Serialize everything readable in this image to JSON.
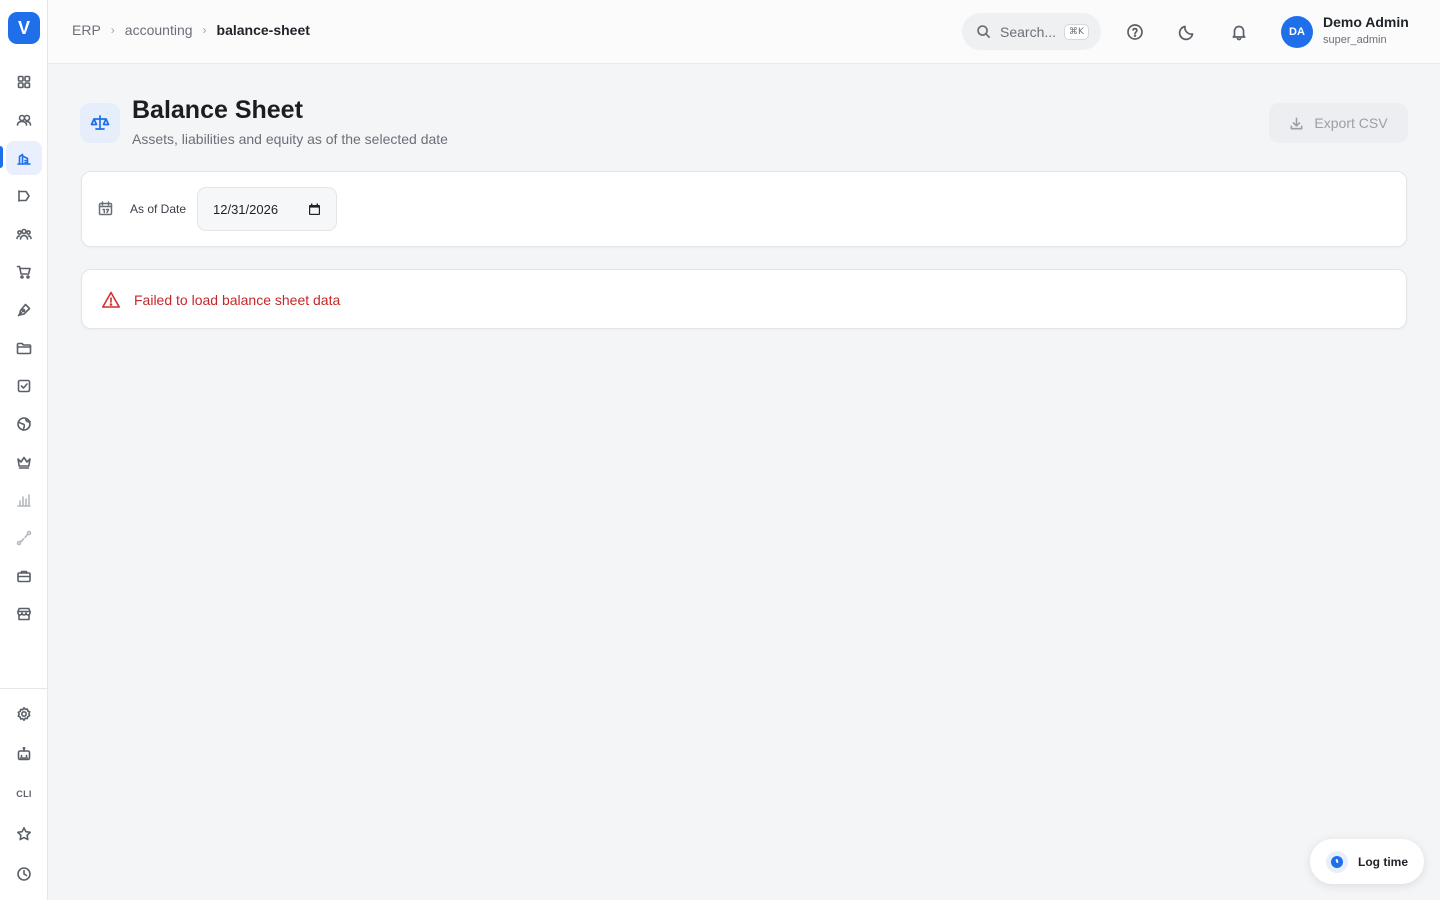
{
  "sidebar": {
    "logo": "V",
    "items": [
      {
        "icon": "dashboard-icon"
      },
      {
        "icon": "users-icon"
      },
      {
        "icon": "accounting-icon",
        "active": true
      },
      {
        "icon": "campaign-icon"
      },
      {
        "icon": "team-icon"
      },
      {
        "icon": "cart-icon"
      },
      {
        "icon": "pen-tool-icon"
      },
      {
        "icon": "folder-icon"
      },
      {
        "icon": "checkbox-icon"
      },
      {
        "icon": "globe-icon"
      },
      {
        "icon": "crown-icon"
      },
      {
        "icon": "bar-chart-icon",
        "disabled": true
      },
      {
        "icon": "route-icon",
        "disabled": true
      },
      {
        "icon": "briefcase-icon"
      },
      {
        "icon": "store-icon"
      }
    ],
    "bottom_items": [
      {
        "icon": "settings-icon"
      },
      {
        "icon": "robot-icon"
      },
      {
        "icon": "cli-icon",
        "label": "CLI"
      },
      {
        "icon": "star-icon"
      },
      {
        "icon": "clock-icon"
      }
    ]
  },
  "topbar": {
    "breadcrumb": [
      "ERP",
      "accounting",
      "balance-sheet"
    ],
    "search_placeholder": "Search...",
    "search_shortcut": "⌘K",
    "user": {
      "initials": "DA",
      "name": "Demo Admin",
      "role": "super_admin"
    }
  },
  "page": {
    "title": "Balance Sheet",
    "subtitle": "Assets, liabilities and equity as of the selected date",
    "export_label": "Export CSV"
  },
  "filter": {
    "label": "As of Date",
    "date_value": "12/31/2026"
  },
  "error": {
    "message": "Failed to load balance sheet data"
  },
  "log_time": {
    "label": "Log time"
  },
  "colors": {
    "accent": "#1f6feb",
    "error": "#c62828",
    "background": "#f4f5f7"
  }
}
